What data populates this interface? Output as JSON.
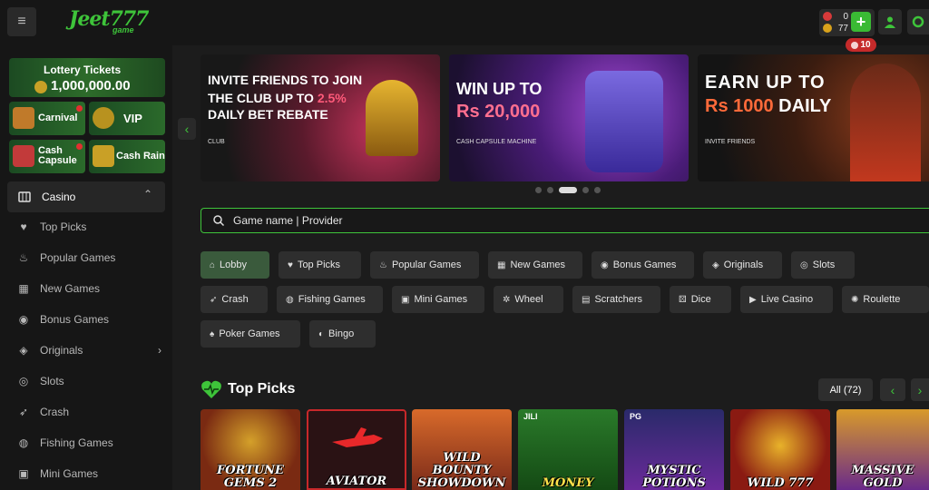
{
  "header": {
    "logo_text": "Jeet777",
    "logo_sub": "game",
    "wallet_rs": "0",
    "wallet_coins": "77",
    "bonus": "10"
  },
  "sidebar": {
    "lottery_title": "Lottery Tickets",
    "lottery_amount": "1,000,000.00",
    "tiles": [
      "Carnival",
      "VIP",
      "Cash Capsule",
      "Cash Rain"
    ],
    "category": "Casino",
    "items": [
      "Top Picks",
      "Popular Games",
      "New Games",
      "Bonus Games",
      "Originals",
      "Slots",
      "Crash",
      "Fishing Games",
      "Mini Games"
    ]
  },
  "banners": [
    {
      "line1": "INVITE FRIENDS TO JOIN",
      "line2a": "THE CLUB UP TO ",
      "line2b": "2.5%",
      "line3": "DAILY BET REBATE",
      "sub": "CLUB"
    },
    {
      "line1": "WIN UP TO",
      "line2": "Rs 20,000",
      "sub": "CASH CAPSULE MACHINE"
    },
    {
      "line1": "EARN UP TO",
      "line2a": "Rs 1000",
      "line2b": " DAILY",
      "sub": "INVITE FRIENDS"
    }
  ],
  "search": {
    "placeholder": "Game name | Provider"
  },
  "chips": [
    {
      "label": "Lobby",
      "icon": "home-icon"
    },
    {
      "label": "Top Picks",
      "icon": "heart-icon"
    },
    {
      "label": "Popular Games",
      "icon": "fire-icon"
    },
    {
      "label": "New Games",
      "icon": "gift-icon"
    },
    {
      "label": "Bonus Games",
      "icon": "bonus-icon"
    },
    {
      "label": "Originals",
      "icon": "originals-icon"
    },
    {
      "label": "Slots",
      "icon": "slots-icon"
    },
    {
      "label": "Crash",
      "icon": "rocket-icon"
    },
    {
      "label": "Fishing Games",
      "icon": "fish-icon"
    },
    {
      "label": "Mini Games",
      "icon": "gamepad-icon"
    },
    {
      "label": "Wheel",
      "icon": "wheel-icon"
    },
    {
      "label": "Scratchers",
      "icon": "scratch-icon"
    },
    {
      "label": "Dice",
      "icon": "dice-icon"
    },
    {
      "label": "Live Casino",
      "icon": "play-icon"
    },
    {
      "label": "Roulette",
      "icon": "roulette-icon"
    },
    {
      "label": "Poker Games",
      "icon": "spade-icon"
    },
    {
      "label": "Bingo",
      "icon": "bingo-icon"
    }
  ],
  "section": {
    "title": "Top Picks",
    "all_label": "All (72)"
  },
  "cards": [
    {
      "title": "FORTUNE GEMS 2",
      "brand": ""
    },
    {
      "title": "AVIATOR",
      "brand": ""
    },
    {
      "title": "WILD BOUNTY SHOWDOWN",
      "brand": ""
    },
    {
      "title": "MONEY",
      "brand": "JILI"
    },
    {
      "title": "MYSTIC POTIONS",
      "brand": "PG"
    },
    {
      "title": "WILD 777",
      "brand": ""
    },
    {
      "title": "MASSIVE GOLD",
      "brand": ""
    }
  ],
  "colors": {
    "accent": "#3ec43a",
    "bg": "#1c1c1c",
    "panel": "#161616"
  }
}
